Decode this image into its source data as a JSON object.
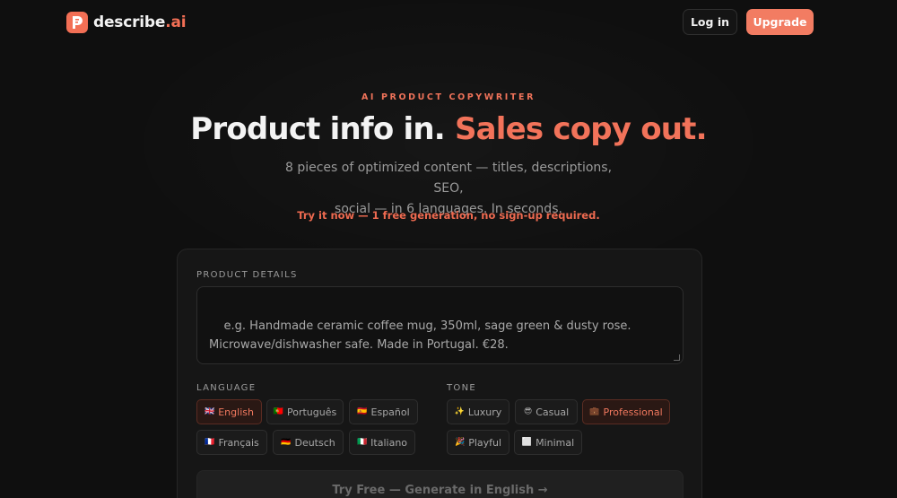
{
  "header": {
    "logo_name": "describe",
    "logo_tld": ".ai",
    "login_label": "Log in",
    "upgrade_label": "Upgrade"
  },
  "hero": {
    "eyebrow": "AI PRODUCT COPYWRITER",
    "headline_main": "Product info in.",
    "headline_accent": "Sales copy out.",
    "subline_1": "8 pieces of optimized content — titles, descriptions, SEO,",
    "subline_2": "social — in 6 languages. In seconds.",
    "try_note": "Try it now — 1 free generation, no sign-up required."
  },
  "form": {
    "product_label": "PRODUCT DETAILS",
    "product_placeholder": "e.g. Handmade ceramic coffee mug, 350ml, sage green & dusty rose.\nMicrowave/dishwasher safe. Made in Portugal. €28.",
    "language_label": "LANGUAGE",
    "languages": [
      {
        "flag": "🇬🇧",
        "label": "English",
        "selected": true
      },
      {
        "flag": "🇵🇹",
        "label": "Português",
        "selected": false
      },
      {
        "flag": "🇪🇸",
        "label": "Español",
        "selected": false
      },
      {
        "flag": "🇫🇷",
        "label": "Français",
        "selected": false
      },
      {
        "flag": "🇩🇪",
        "label": "Deutsch",
        "selected": false
      },
      {
        "flag": "🇮🇹",
        "label": "Italiano",
        "selected": false
      }
    ],
    "tone_label": "TONE",
    "tones": [
      {
        "icon": "✨",
        "label": "Luxury",
        "selected": false
      },
      {
        "icon": "😎",
        "label": "Casual",
        "selected": false
      },
      {
        "icon": "💼",
        "label": "Professional",
        "selected": true
      },
      {
        "icon": "🎉",
        "label": "Playful",
        "selected": false
      },
      {
        "icon": "⬜",
        "label": "Minimal",
        "selected": false
      }
    ],
    "generate_label": "Try Free — Generate in English →"
  },
  "colors": {
    "accent": "#f2735a",
    "background": "#0f0f0f",
    "card": "#161616"
  }
}
